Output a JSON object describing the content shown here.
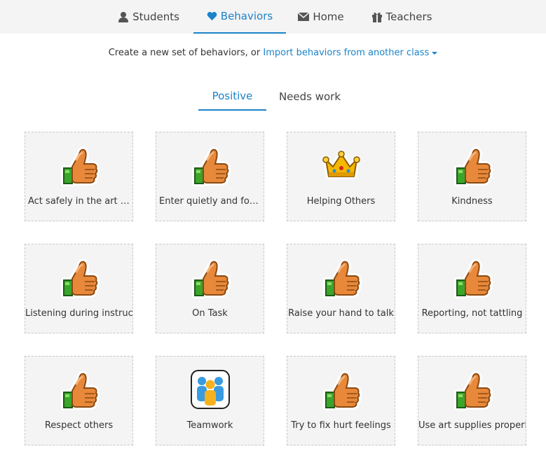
{
  "nav": {
    "tabs": [
      {
        "label": "Students",
        "icon": "person-icon"
      },
      {
        "label": "Behaviors",
        "icon": "heart-icon",
        "active": true
      },
      {
        "label": "Home",
        "icon": "envelope-icon"
      },
      {
        "label": "Teachers",
        "icon": "gift-icon"
      }
    ]
  },
  "prompt": {
    "text": "Create a new set of behaviors, or",
    "link": "Import behaviors from another class"
  },
  "subtabs": [
    {
      "label": "Positive",
      "active": true
    },
    {
      "label": "Needs work",
      "active": false
    }
  ],
  "behaviors": [
    {
      "label": "Act safely in the art ro...",
      "icon": "thumbs-up-icon"
    },
    {
      "label": "Enter quietly and follow...",
      "icon": "thumbs-up-icon"
    },
    {
      "label": "Helping Others",
      "icon": "crown-icon"
    },
    {
      "label": "Kindness",
      "icon": "thumbs-up-icon"
    },
    {
      "label": "Listening during instructi",
      "icon": "thumbs-up-icon"
    },
    {
      "label": "On Task",
      "icon": "thumbs-up-icon"
    },
    {
      "label": "Raise your hand to talk",
      "icon": "thumbs-up-icon"
    },
    {
      "label": "Reporting, not tattling",
      "icon": "thumbs-up-icon"
    },
    {
      "label": "Respect others",
      "icon": "thumbs-up-icon"
    },
    {
      "label": "Teamwork",
      "icon": "team-icon"
    },
    {
      "label": "Try to fix hurt feelings",
      "icon": "thumbs-up-icon"
    },
    {
      "label": "Use art supplies properly",
      "icon": "thumbs-up-icon"
    }
  ],
  "colors": {
    "accent": "#1b83c9",
    "card_bg": "#f4f4f4",
    "nav_bg": "#f4f4f4"
  }
}
